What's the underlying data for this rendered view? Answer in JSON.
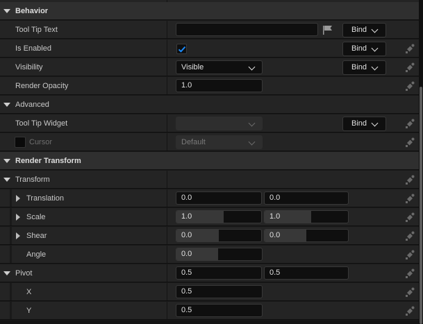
{
  "sections": {
    "behavior": "Behavior",
    "advanced": "Advanced",
    "render_transform": "Render Transform",
    "transform": "Transform"
  },
  "props": {
    "tooltip_text": {
      "label": "Tool Tip Text",
      "value": ""
    },
    "is_enabled": {
      "label": "Is Enabled",
      "checked": true
    },
    "visibility": {
      "label": "Visibility",
      "value": "Visible"
    },
    "render_opacity": {
      "label": "Render Opacity",
      "value": "1.0"
    },
    "tooltip_widget": {
      "label": "Tool Tip Widget",
      "value": ""
    },
    "cursor": {
      "label": "Cursor",
      "value": "Default",
      "enabled": false
    },
    "translation": {
      "label": "Translation",
      "x": "0.0",
      "y": "0.0"
    },
    "scale": {
      "label": "Scale",
      "x": "1.0",
      "y": "1.0",
      "fill": 0.56
    },
    "shear": {
      "label": "Shear",
      "x": "0.0",
      "y": "0.0",
      "fill": 0.5
    },
    "angle": {
      "label": "Angle",
      "value": "0.0",
      "fill": 0.49
    },
    "pivot": {
      "label": "Pivot",
      "x": "0.5",
      "y": "0.5"
    },
    "pivot_x": {
      "label": "X",
      "value": "0.5"
    },
    "pivot_y": {
      "label": "Y",
      "value": "0.5"
    }
  },
  "bind_label": "Bind",
  "icons": {
    "reset": "reset-to-default-icon",
    "flag": "flag-icon",
    "check": "checkmark-icon"
  },
  "colors": {
    "accent": "#1a8cff",
    "background": "#242424",
    "section": "#2f2f2f",
    "field": "#0f0f0f"
  }
}
